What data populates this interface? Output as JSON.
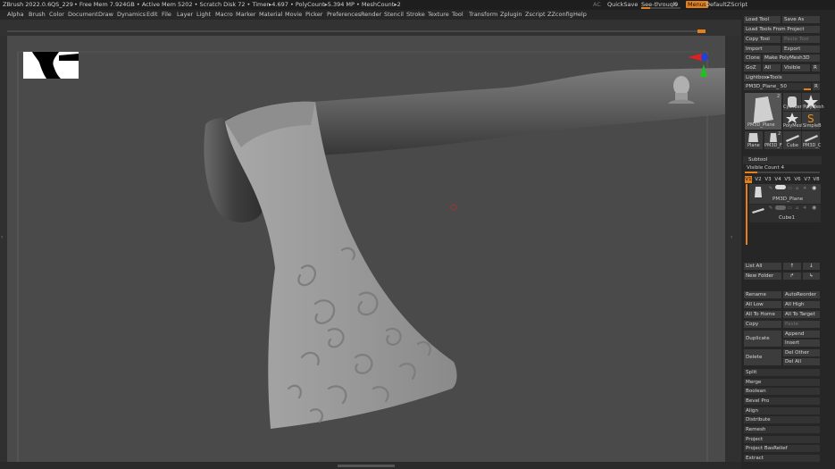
{
  "titlebar": {
    "app": "ZBrush 2022.0.6",
    "doc": "QS_229",
    "stats": "• Free Mem 7.924GB • Active Mem 5202 • Scratch Disk 72 • Timer▸4.697 • PolyCount▸5.394 MP • MeshCount▸2",
    "ac": "AC",
    "quicksave": "QuickSave",
    "see_through": "See-through",
    "see_through_value": "0",
    "menus": "Menus",
    "script": "DefaultZScript"
  },
  "menubar": [
    "Alpha",
    "Brush",
    "Color",
    "Document",
    "Draw",
    "Dynamics",
    "Edit",
    "File",
    "Layer",
    "Light",
    "Macro",
    "Marker",
    "Material",
    "Movie",
    "Picker",
    "Preferences",
    "Render",
    "Stencil",
    "Stroke",
    "Texture",
    "Tool",
    "Transform",
    "Zplugin",
    "Zscript",
    "ZZconfig",
    "Help"
  ],
  "tool_panel": {
    "load_tool": "Load Tool",
    "save_as": "Save As",
    "load_from_project": "Load Tools From Project",
    "copy_tool": "Copy Tool",
    "paste_tool": "Paste Tool",
    "import": "Import",
    "export": "Export",
    "clone": "Clone",
    "make_polymesh": "Make PolyMesh3D",
    "goz": "GoZ",
    "all": "All",
    "visible": "Visible",
    "r": "R",
    "lightbox_tools": "Lightbox▸Tools",
    "current_tool": "PM3D_Plane_ 50",
    "r2": "R",
    "thumbs": [
      {
        "label": "PM3D_Plane",
        "count": "2"
      },
      {
        "label": "Cylinder PolyMesh"
      },
      {
        "label": "PolyMesh"
      },
      {
        "label": "SimpleB"
      },
      {
        "label": "Plane"
      },
      {
        "label": "PM3D_F",
        "count": "2"
      },
      {
        "label": "Cube"
      },
      {
        "label": "PM3D_C"
      }
    ]
  },
  "subtool": {
    "header": "Subtool",
    "visible_count": "Visible Count 4",
    "versions": [
      "V1",
      "V2",
      "V3",
      "V4",
      "V5",
      "V6",
      "V7",
      "V8"
    ],
    "items": [
      {
        "name": "PM3D_Plane"
      },
      {
        "name": "Cube1"
      }
    ],
    "list_all": "List All",
    "new_folder": "New Folder",
    "rename": "Rename",
    "auto_reorder": "AutoReorder",
    "all_low": "All Low",
    "all_high": "All High",
    "all_to_home": "All To Home",
    "all_to_target": "All To Target",
    "copy": "Copy",
    "paste": "Paste",
    "duplicate": "Duplicate",
    "append": "Append",
    "insert": "Insert",
    "delete": "Delete",
    "del_other": "Del Other",
    "del_all": "Del All",
    "split": "Split",
    "merge": "Merge",
    "boolean": "Boolean",
    "bevel_pro": "Bevel Pro",
    "align": "Align",
    "distribute": "Distribute",
    "remesh": "Remesh",
    "project": "Project",
    "project_basrelief": "Project BasRelief",
    "extract": "Extract"
  },
  "colors": {
    "accent": "#e2801e",
    "viewport": "#4a4a4a",
    "panel": "#262626",
    "button": "#3c3c3c"
  }
}
